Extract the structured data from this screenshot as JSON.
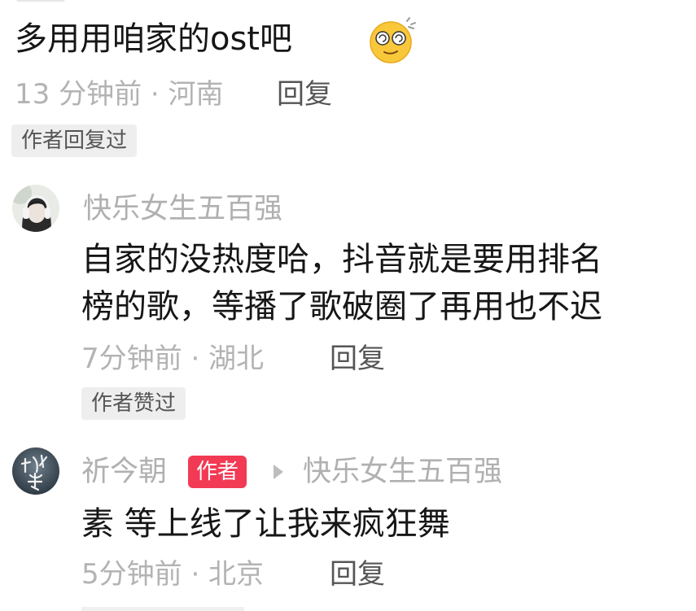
{
  "comment_top": {
    "text": "多用用咱家的ost吧",
    "emoji": "dizzy-face-emoji",
    "time": "13 分钟前 · 河南",
    "reply_label": "回复",
    "badge": "作者回复过"
  },
  "comment_2": {
    "username": "快乐女生五百强",
    "text_line1": "自家的没热度哈，抖音就是要用排名",
    "text_line2": "榜的歌，等播了歌破圈了再用也不迟",
    "time": "7分钟前 · 湖北",
    "reply_label": "回复",
    "badge": "作者赞过",
    "avatar": "user-avatar-headphones-icon"
  },
  "comment_3": {
    "username": "祈今朝",
    "author_badge": "作者",
    "reply_to": "快乐女生五百强",
    "text": "素 等上线了让我来疯狂舞",
    "time": "5分钟前 · 北京",
    "reply_label": "回复",
    "avatar": "author-avatar-calligraphy-icon"
  },
  "colors": {
    "text": "#161616",
    "meta": "#b3b3b3",
    "badge_bg": "#eeeeee",
    "author_badge": "#f23a54"
  }
}
